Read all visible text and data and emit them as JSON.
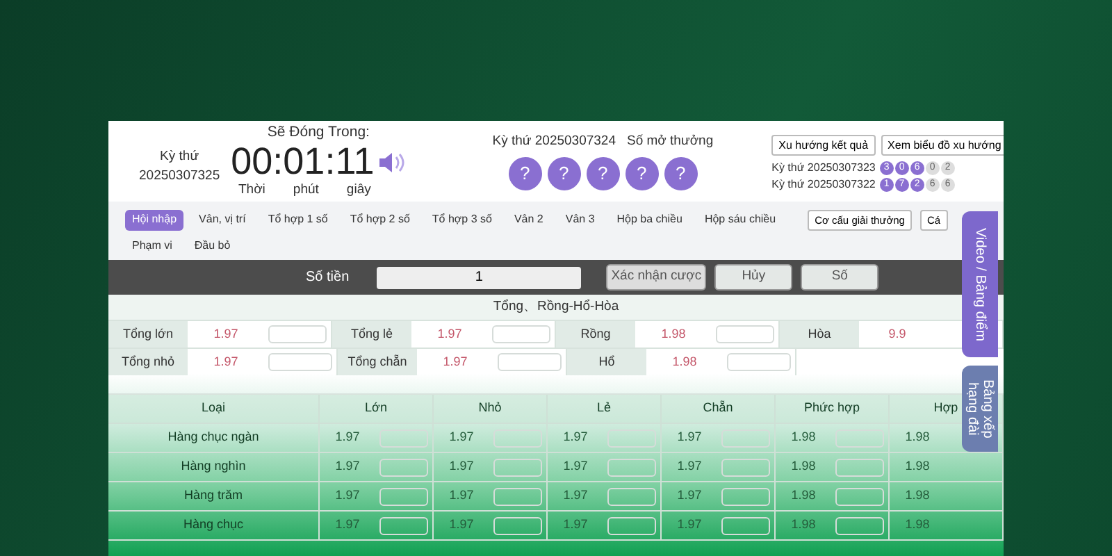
{
  "header": {
    "draw_label": "Kỳ thứ",
    "draw_number": "20250307325",
    "countdown_title": "Sẽ Đóng Trong:",
    "countdown": "00:01:11",
    "countdown_units": [
      "Thời",
      "phút",
      "giây"
    ]
  },
  "result_panel": {
    "label": "Kỳ thứ 20250307324",
    "title": "Số mở thưởng",
    "balls": [
      "?",
      "?",
      "?",
      "?",
      "?"
    ]
  },
  "trend_buttons": [
    "Xu hướng kết quả",
    "Xem biểu đồ xu hướng"
  ],
  "history": [
    {
      "label": "Kỳ thứ 20250307323",
      "balls": [
        {
          "value": "3",
          "highlighted": true
        },
        {
          "value": "0",
          "highlighted": true
        },
        {
          "value": "6",
          "highlighted": true
        },
        {
          "value": "0",
          "highlighted": false
        },
        {
          "value": "2",
          "highlighted": false
        }
      ]
    },
    {
      "label": "Kỳ thứ 20250307322",
      "balls": [
        {
          "value": "1",
          "highlighted": true
        },
        {
          "value": "7",
          "highlighted": true
        },
        {
          "value": "2",
          "highlighted": true
        },
        {
          "value": "6",
          "highlighted": false
        },
        {
          "value": "6",
          "highlighted": false
        }
      ]
    }
  ],
  "tabs": [
    {
      "label": "Hội nhập",
      "selected": true
    },
    {
      "label": "Vân, vị trí",
      "selected": false
    },
    {
      "label": "Tổ hợp 1 số",
      "selected": false
    },
    {
      "label": "Tổ hợp 2 số",
      "selected": false
    },
    {
      "label": "Tổ hợp 3 số",
      "selected": false
    },
    {
      "label": "Vân 2",
      "selected": false
    },
    {
      "label": "Vân 3",
      "selected": false
    },
    {
      "label": "Hộp ba chiều",
      "selected": false
    },
    {
      "label": "Hộp sáu chiều",
      "selected": false
    },
    {
      "label": "Phạm vi",
      "selected": false
    },
    {
      "label": "Đầu bỏ",
      "selected": false
    }
  ],
  "tab_buttons": [
    "Cơ cấu giải thưởng",
    "Cá"
  ],
  "bet_bar": {
    "amount_label": "Số tiền",
    "amount": "1",
    "buttons": [
      "Xác nhận cược",
      "Hủy",
      "Số"
    ]
  },
  "sum_section": {
    "title": "Tổng、Rồng-Hổ-Hòa",
    "rows": [
      [
        {
          "label": "Tổng lớn",
          "odds": "1.97"
        },
        {
          "label": "Tổng lẻ",
          "odds": "1.97"
        },
        {
          "label": "Rồng",
          "odds": "1.98"
        },
        {
          "label": "Hòa",
          "odds": "9.9"
        }
      ],
      [
        {
          "label": "Tổng nhỏ",
          "odds": "1.97"
        },
        {
          "label": "Tổng chẵn",
          "odds": "1.97"
        },
        {
          "label": "Hổ",
          "odds": "1.98"
        }
      ]
    ]
  },
  "position_table": {
    "columns": [
      "Loại",
      "Lớn",
      "Nhỏ",
      "Lẻ",
      "Chẵn",
      "Phức hợp",
      "Hợp"
    ],
    "rows": [
      {
        "name": "Hàng chục ngàn",
        "odds": [
          "1.97",
          "1.97",
          "1.97",
          "1.97",
          "1.98",
          "1.98"
        ]
      },
      {
        "name": "Hàng nghìn",
        "odds": [
          "1.97",
          "1.97",
          "1.97",
          "1.97",
          "1.98",
          "1.98"
        ]
      },
      {
        "name": "Hàng trăm",
        "odds": [
          "1.97",
          "1.97",
          "1.97",
          "1.97",
          "1.98",
          "1.98"
        ]
      },
      {
        "name": "Hàng chục",
        "odds": [
          "1.97",
          "1.97",
          "1.97",
          "1.97",
          "1.98",
          "1.98"
        ]
      }
    ]
  },
  "side_tabs": [
    "Video / Bảng điểm",
    "Bảng xếp hạng đài"
  ]
}
